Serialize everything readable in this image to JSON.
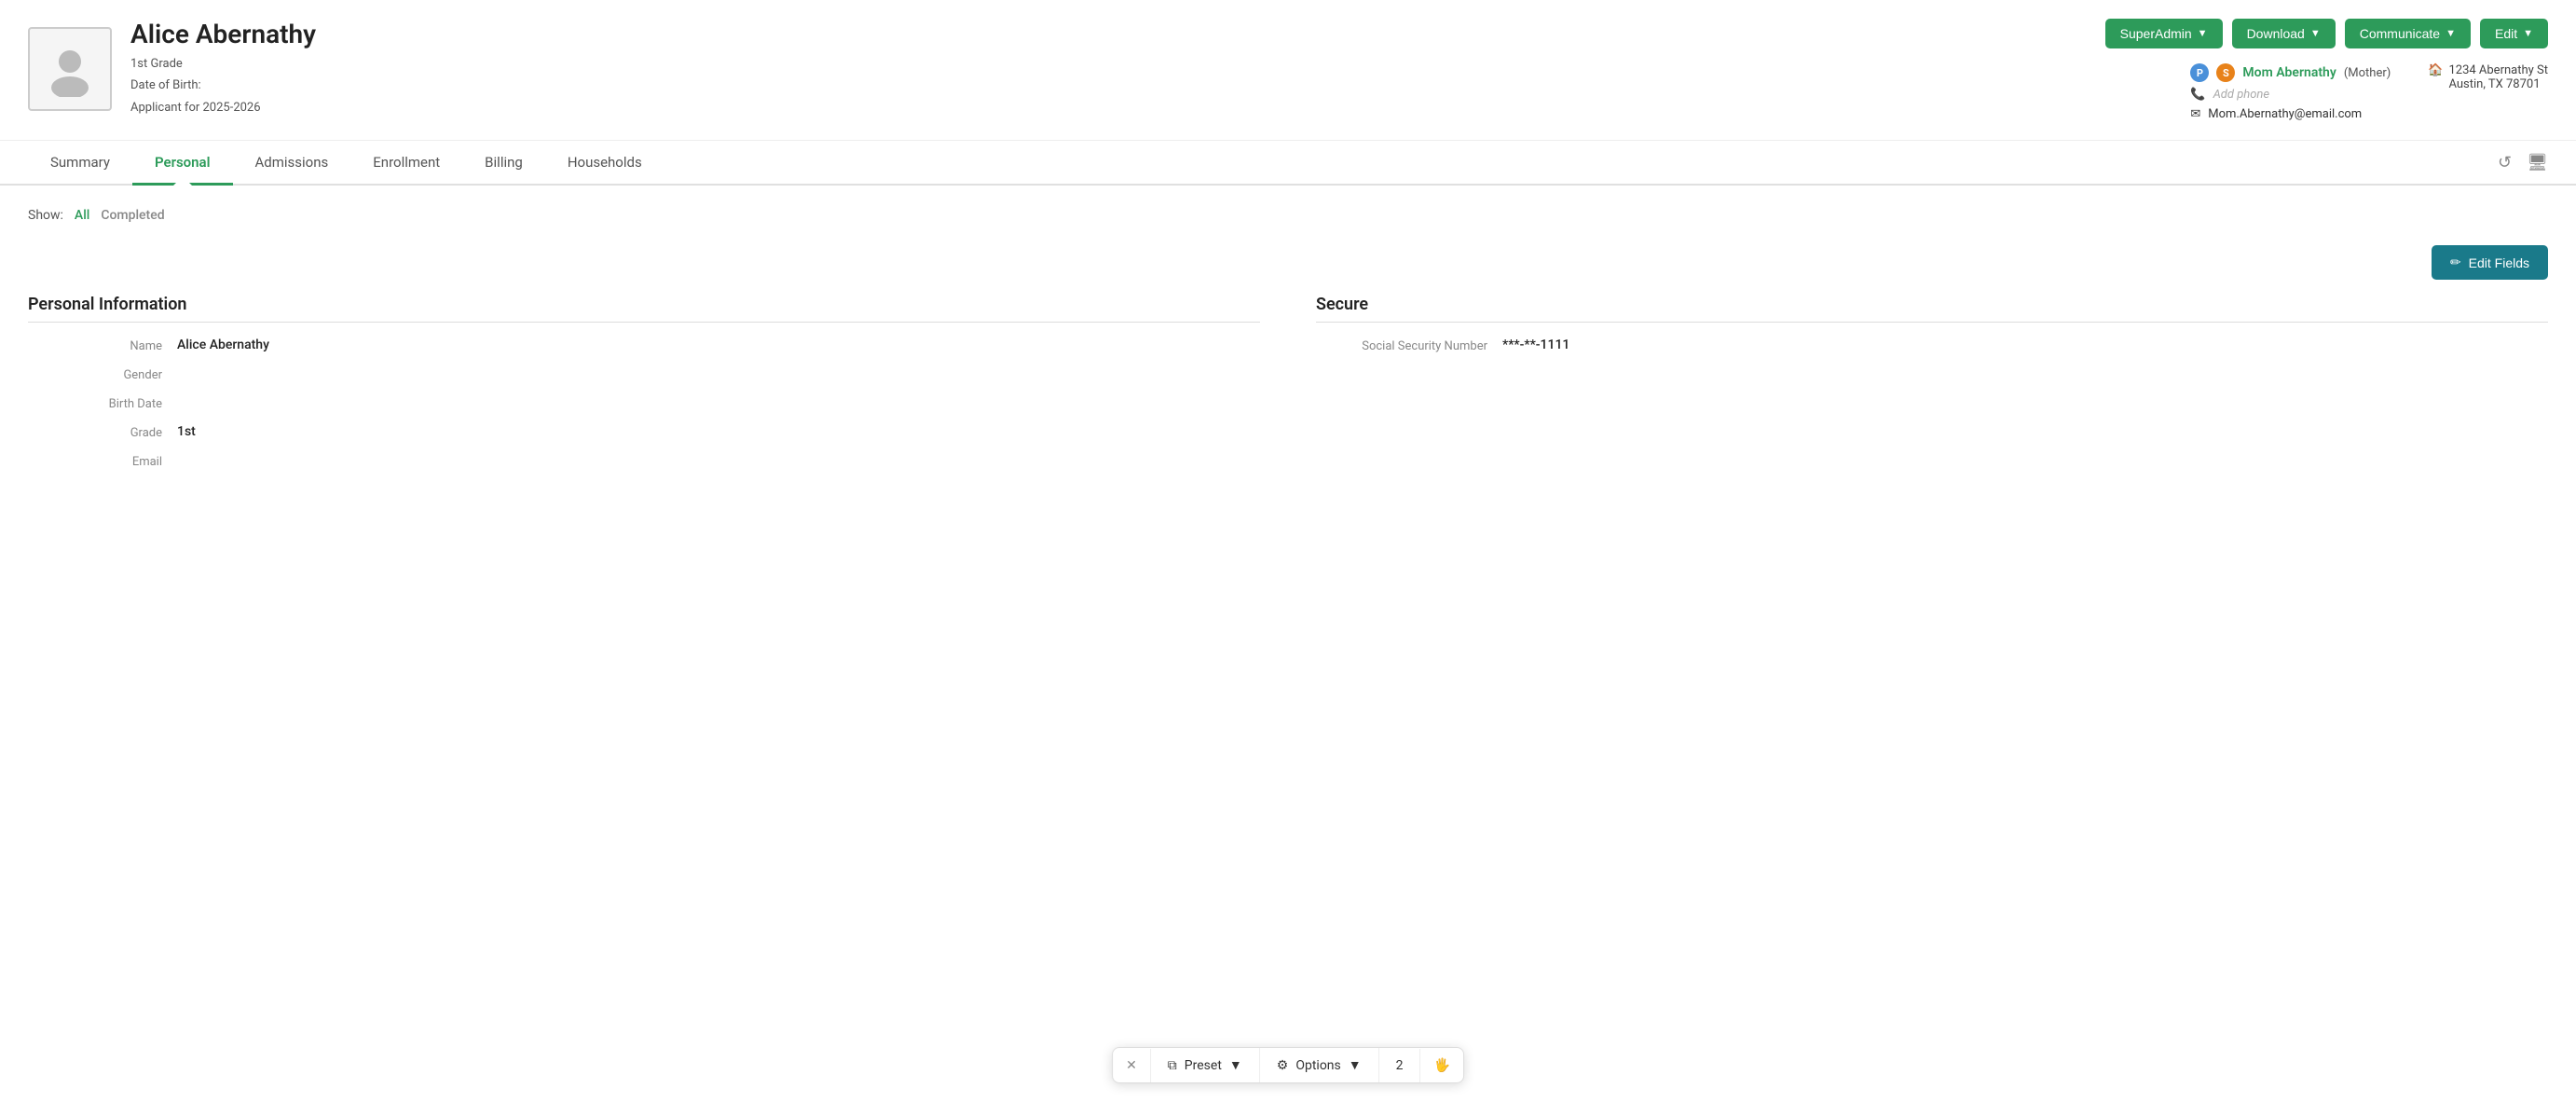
{
  "header": {
    "student_name": "Alice Abernathy",
    "grade": "1st Grade",
    "dob_label": "Date of Birth:",
    "applicant_label": "Applicant for 2025-2026",
    "actions": {
      "superadmin_label": "SuperAdmin",
      "download_label": "Download",
      "communicate_label": "Communicate",
      "edit_label": "Edit"
    },
    "contact": {
      "mom_name": "Mom Abernathy",
      "mom_role": "(Mother)",
      "add_phone": "Add phone",
      "email": "Mom.Abernathy@email.com",
      "address_line1": "1234 Abernathy St",
      "address_line2": "Austin, TX 78701"
    }
  },
  "tabs": {
    "items": [
      {
        "id": "summary",
        "label": "Summary",
        "active": false
      },
      {
        "id": "personal",
        "label": "Personal",
        "active": true
      },
      {
        "id": "admissions",
        "label": "Admissions",
        "active": false
      },
      {
        "id": "enrollment",
        "label": "Enrollment",
        "active": false
      },
      {
        "id": "billing",
        "label": "Billing",
        "active": false
      },
      {
        "id": "households",
        "label": "Households",
        "active": false
      }
    ]
  },
  "show_filter": {
    "label": "Show:",
    "all": "All",
    "completed": "Completed"
  },
  "edit_fields_button": "✏ Edit Fields",
  "personal_info": {
    "title": "Personal Information",
    "fields": [
      {
        "label": "Name",
        "value": "Alice Abernathy"
      },
      {
        "label": "Gender",
        "value": ""
      },
      {
        "label": "Birth Date",
        "value": ""
      },
      {
        "label": "Grade",
        "value": "1st"
      },
      {
        "label": "Email",
        "value": ""
      }
    ]
  },
  "secure_info": {
    "title": "Secure",
    "fields": [
      {
        "label": "Social Security Number",
        "value": "***-**-1111"
      }
    ]
  },
  "toolbar": {
    "preset_label": "Preset",
    "options_label": "Options",
    "count": "2"
  }
}
